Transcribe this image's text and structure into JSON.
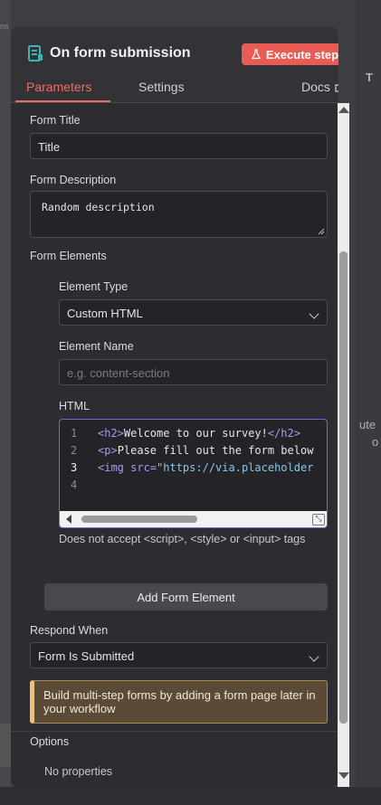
{
  "background": {
    "left_text": "ns",
    "right_text_top": "T",
    "right_text_lines": [
      "ute",
      "o"
    ]
  },
  "header": {
    "title": "On form submission",
    "execute_label": "Execute step",
    "icon": "form-icon"
  },
  "tabs": [
    {
      "label": "Parameters",
      "active": true
    },
    {
      "label": "Settings",
      "active": false
    }
  ],
  "docs_label": "Docs",
  "form": {
    "title_label": "Form Title",
    "title_value": "Title",
    "description_label": "Form Description",
    "description_value": "Random description",
    "elements_label": "Form Elements",
    "element_type_label": "Element Type",
    "element_type_value": "Custom HTML",
    "element_name_label": "Element Name",
    "element_name_placeholder": "e.g. content-section",
    "html_label": "HTML",
    "html_lines": [
      {
        "num": "1",
        "open": "<h2>",
        "text": "Welcome to our survey!",
        "close": "</h2>"
      },
      {
        "num": "2",
        "open": "<p>",
        "text": "Please fill out the form below"
      },
      {
        "num": "3",
        "tag": "<img",
        "attr": " src=",
        "str": "\"https://via.placeholder"
      },
      {
        "num": "4"
      }
    ],
    "html_hint": "Does not accept <script>, <style> or <input> tags",
    "add_element_label": "Add Form Element",
    "respond_label": "Respond When",
    "respond_value": "Form Is Submitted",
    "notice_text": "Build multi-step forms by adding a form page later in your workflow",
    "options_label": "Options",
    "no_properties": "No properties"
  },
  "colors": {
    "accent": "#ee6d63",
    "execute_bg": "#e95b55",
    "panel_bg": "#333337",
    "editor_focus": "#6e6ad8",
    "notice_bg": "#5b4a35"
  }
}
